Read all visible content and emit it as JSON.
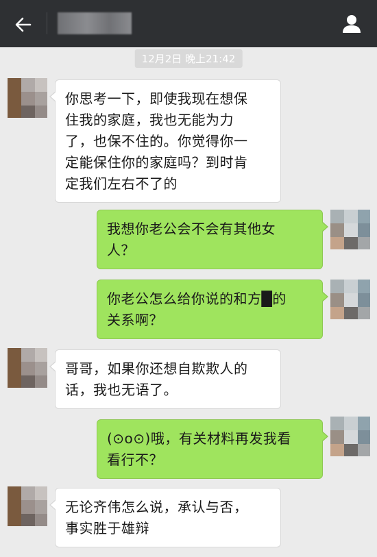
{
  "header": {
    "back_icon": "arrow-left-icon",
    "title": "████",
    "profile_icon": "person-icon",
    "background": "#2e3033"
  },
  "timestamp": "12月2日 晚上21:42",
  "messages": [
    {
      "side": "in",
      "text": "你思考一下，即使我现在想保\n住我的家庭，我也无能为力\n了，也保不住的。你觉得你一\n定能保住你的家庭吗？到时肯\n定我们左右不了的"
    },
    {
      "side": "out",
      "text": "我想你老公会不会有其他女\n人？"
    },
    {
      "side": "out",
      "text": "你老公怎么给你说的和方█的\n关系啊？"
    },
    {
      "side": "in",
      "text": "哥哥，如果你还想自欺欺人的\n话，我也无语了。"
    },
    {
      "side": "out",
      "text": "(⊙o⊙)哦，有关材料再发我看\n看行不？"
    },
    {
      "side": "in",
      "text": "无论齐伟怎么说，承认与否，\n事实胜于雄辩"
    }
  ],
  "colors": {
    "chat_background": "#ebebeb",
    "incoming_bubble": "#ffffff",
    "outgoing_bubble": "#9fe45e"
  }
}
